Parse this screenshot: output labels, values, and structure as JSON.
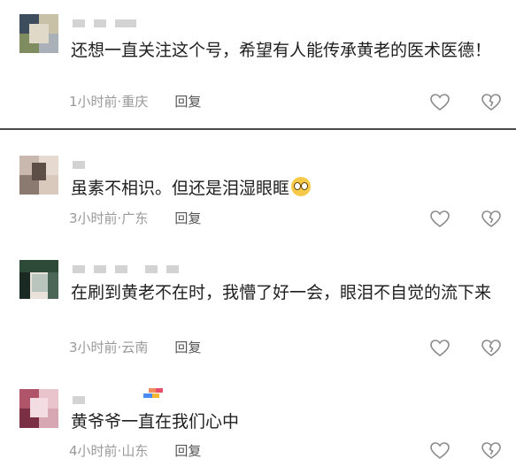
{
  "comments": [
    {
      "text": "还想一直关注这个号，希望有人能传承黄老的医术医德！",
      "time": "1小时前",
      "location": "重庆",
      "reply_label": "回复",
      "avatar_colors": [
        "#3d4d5e",
        "#c9c0a8",
        "#7e8c60",
        "#2e3b4a",
        "#aab0b8",
        "#e0d8c8"
      ]
    },
    {
      "text": "虽素不相识。但还是泪湿眼眶",
      "emoji": "teary-face-emoji",
      "time": "3小时前",
      "location": "广东",
      "reply_label": "回复",
      "avatar_colors": [
        "#c8b8ae",
        "#e6d9d0",
        "#8a7a70",
        "#5d4f46",
        "#d9c9bd",
        "#f0e6de"
      ]
    },
    {
      "text": "在刷到黄老不在时，我懵了好一会，眼泪不自觉的流下来",
      "time": "3小时前",
      "location": "云南",
      "reply_label": "回复",
      "avatar_colors": [
        "#2d4a39",
        "#e8e2da",
        "#1a2a22",
        "#b9c4bc",
        "#4b6656",
        "#f2eeea"
      ]
    },
    {
      "text": "黄爷爷一直在我们心中",
      "time": "4小时前",
      "location": "山东",
      "reply_label": "回复",
      "avatar_colors": [
        "#b0546a",
        "#e9c4cc",
        "#7b2f44",
        "#d7a8b4",
        "#f3dde2",
        "#9c4058"
      ]
    }
  ],
  "meta_separator": "·",
  "icons": {
    "like": "heart-icon",
    "dislike": "broken-heart-icon"
  },
  "colors": {
    "meta": "#999999",
    "reply": "#555555",
    "divider": "#4a4a4a",
    "icon": "#8a8a8a"
  }
}
